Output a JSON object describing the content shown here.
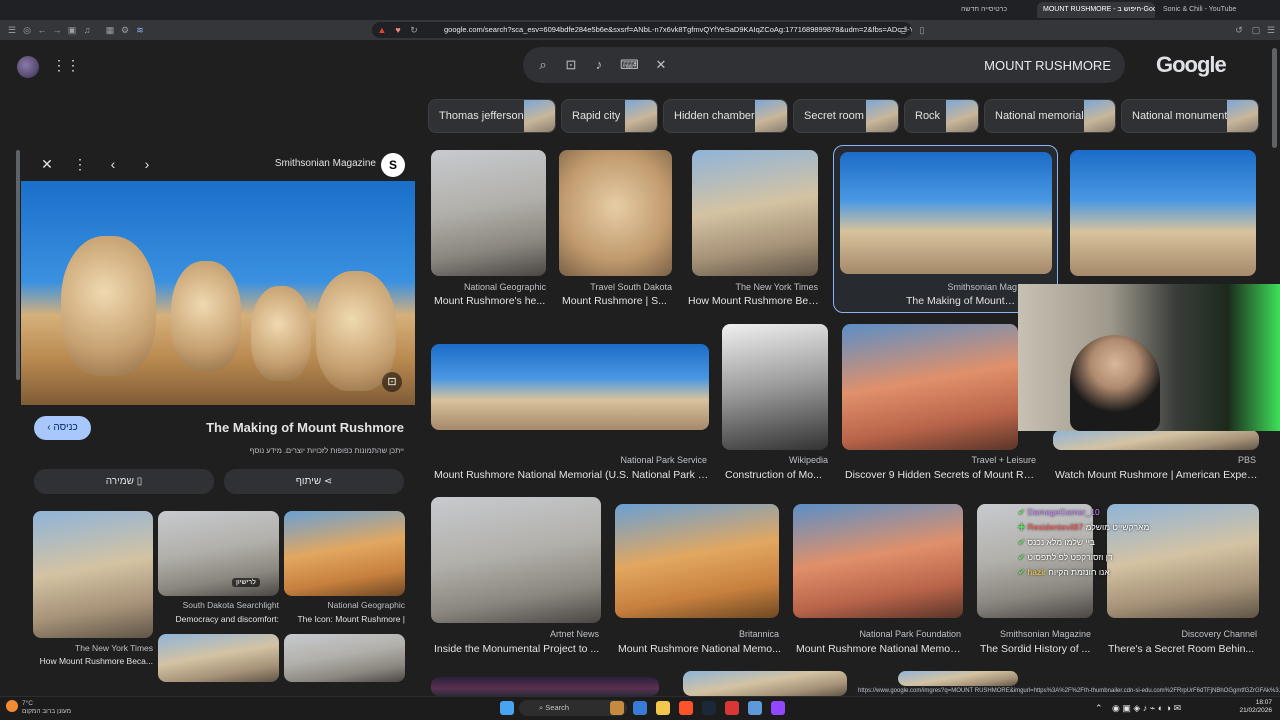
{
  "browser": {
    "tabs": [
      {
        "label": "כרטיסייה חדשה",
        "active": false
      },
      {
        "label": "MOUNT RUSHMORE - חיפוש ב-Google",
        "active": true
      },
      {
        "label": "Sonic & Chili - YouTube",
        "active": false
      }
    ],
    "url": "google.com/search?sca_esv=6094bdfe284e5b6e&sxsrf=ANbL-n7x6vk8TgfmvQYfYeSaD9KAIqZCoAg:1771689899878&udm=2&fbs=ADc_l-YtYeO..."
  },
  "search": {
    "query": "MOUNT RUSHMORE",
    "logo": "Google"
  },
  "chips": [
    {
      "label": "Thomas jefferson"
    },
    {
      "label": "Rapid city"
    },
    {
      "label": "Hidden chamber"
    },
    {
      "label": "Secret room"
    },
    {
      "label": "Rock"
    },
    {
      "label": "National memorial"
    },
    {
      "label": "National monument"
    }
  ],
  "panel": {
    "source": "Smithsonian Magazine",
    "source_badge": "S",
    "title": "The Making of Mount Rushmore",
    "note": "ייתכן שהתמונות כפופות לזכויות יוצרים. מידע נוסף",
    "visit_label": "כניסה",
    "save_label": "שמירה",
    "share_label": "שיתוף",
    "related": [
      {
        "source": "The New York Times",
        "caption": "How Mount Rushmore Beca..."
      },
      {
        "source": "South Dakota Searchlight",
        "caption": "Democracy and discomfort:",
        "badge": "לרישיון"
      },
      {
        "source": "National Geographic",
        "caption": "The Icon: Mount Rushmore |"
      }
    ]
  },
  "results": [
    {
      "source": "National Geographic",
      "caption": "Mount Rushmore's he..."
    },
    {
      "source": "Travel South Dakota",
      "caption": "Mount Rushmore | S..."
    },
    {
      "source": "The New York Times",
      "caption": "How Mount Rushmore Bec..."
    },
    {
      "source": "Smithsonian Mag",
      "caption": "The Making of Mount Ru"
    },
    {
      "source": "",
      "caption": ""
    },
    {
      "source": "National Park Service",
      "caption": "Mount Rushmore National Memorial (U.S. National Park S..."
    },
    {
      "source": "Wikipedia",
      "caption": "Construction of Mo..."
    },
    {
      "source": "Travel + Leisure",
      "caption": "Discover 9 Hidden Secrets of Mount Ru..."
    },
    {
      "source": "PBS",
      "caption": "Watch Mount Rushmore | American Experi..."
    },
    {
      "source": "Artnet News",
      "caption": "Inside the Monumental Project to ..."
    },
    {
      "source": "Britannica",
      "caption": "Mount Rushmore National Memo..."
    },
    {
      "source": "National Park Foundation",
      "caption": "Mount Rushmore National Memori..."
    },
    {
      "source": "Smithsonian Magazine",
      "caption": "The Sordid History of ..."
    },
    {
      "source": "Discovery Channel",
      "caption": "There's a Secret Room Behin..."
    }
  ],
  "chat": [
    {
      "user": "DamageGamer_10",
      "text": ""
    },
    {
      "user": "Residentevil87",
      "text": "מארקשייט מושלמ"
    },
    {
      "user": "",
      "text": "ביי שלמו מלא נכנס"
    },
    {
      "user": "",
      "text": "דן וזסורקפט לפ לתפסוט"
    },
    {
      "user": "hazir",
      "text": "אנו חונזמת הקיוח"
    }
  ],
  "status_url": "https://www.google.com/imgres?q=MOUNT RUSHMORE&imgurl=https%3A%2F%2Fth-thumbnailer.cdn-si-edu.com%2FRrpUrF6dTFjNBhOGgmtfGZrGFAk%3...",
  "taskbar": {
    "search_placeholder": "Search",
    "time": "18:07",
    "date": "21/02/2026",
    "weather_temp": "7°C",
    "weather_desc": "מעונן ברוב המקום"
  },
  "colors": {
    "background": "#1f1f1f",
    "accent": "#8ab4f8",
    "visit_button": "#a8c7fa"
  }
}
